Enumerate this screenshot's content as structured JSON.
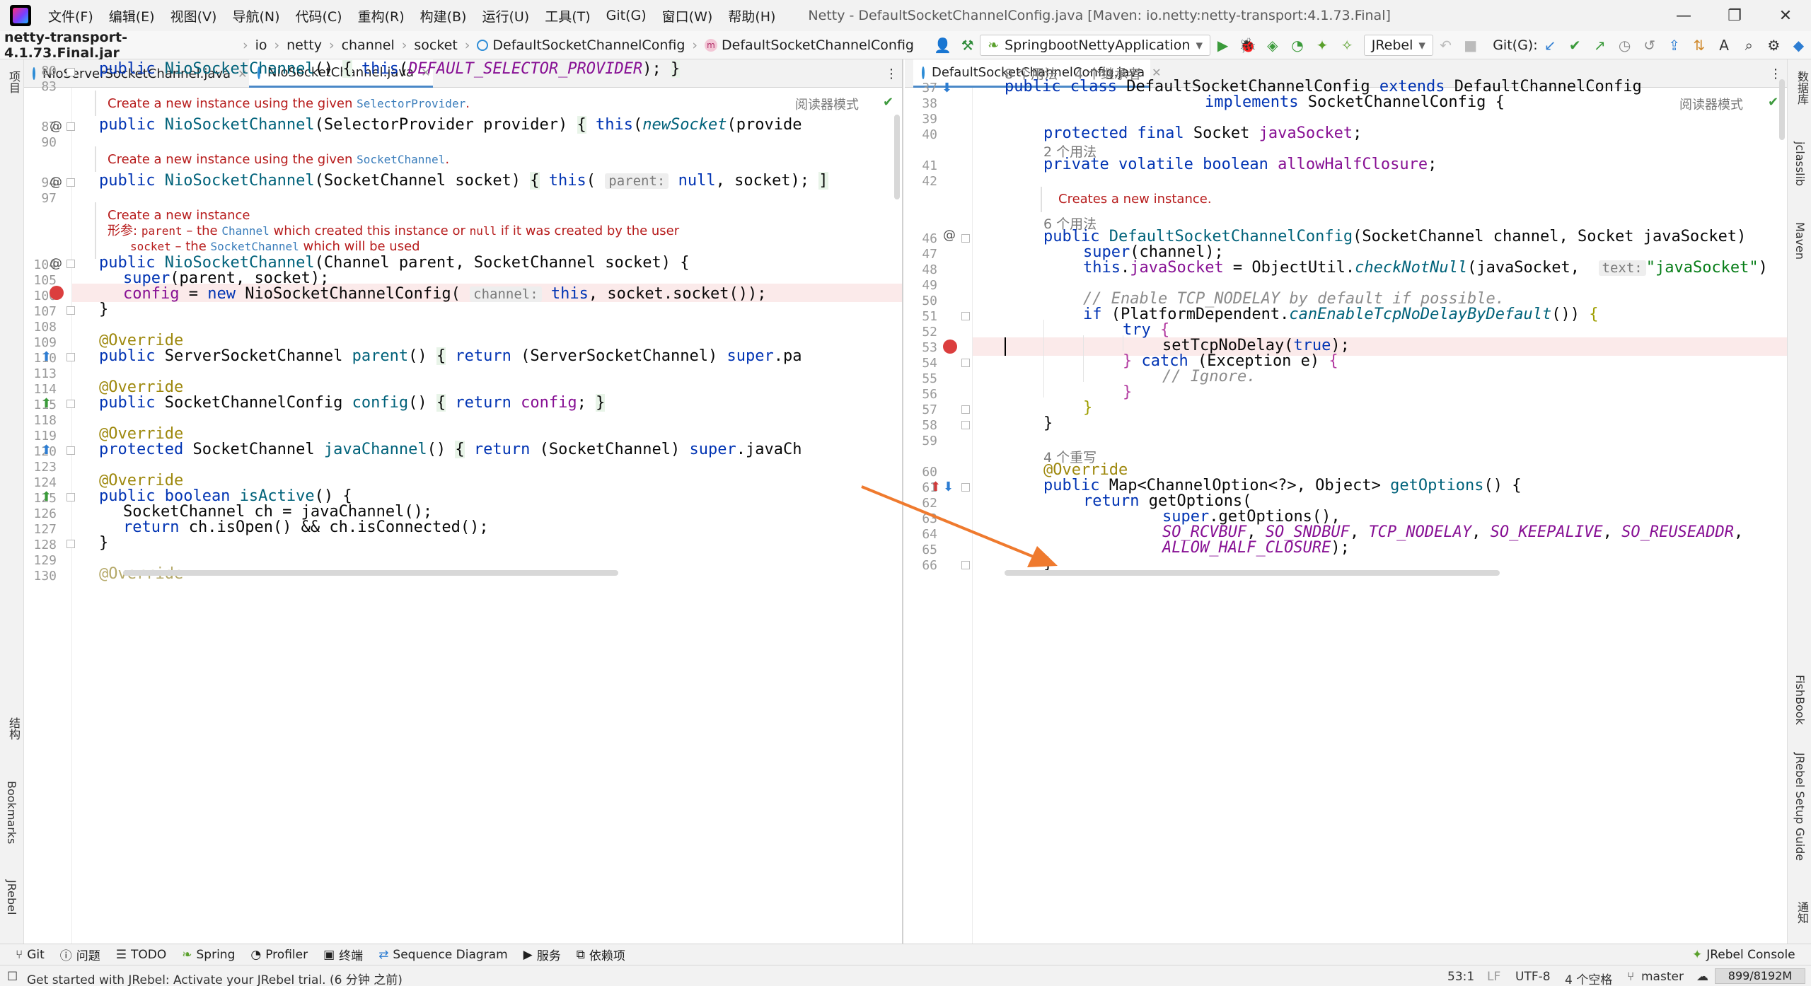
{
  "menu": {
    "items": [
      "文件(F)",
      "编辑(E)",
      "视图(V)",
      "导航(N)",
      "代码(C)",
      "重构(R)",
      "构建(B)",
      "运行(U)",
      "工具(T)",
      "Git(G)",
      "窗口(W)",
      "帮助(H)"
    ],
    "window_title": "Netty - DefaultSocketChannelConfig.java [Maven: io.netty:netty-transport:4.1.73.Final]"
  },
  "breadcrumb": {
    "jar": "netty-transport-4.1.73.Final.jar",
    "parts": [
      "io",
      "netty",
      "channel",
      "socket",
      "DefaultSocketChannelConfig",
      "DefaultSocketChannelConfig"
    ]
  },
  "toolbar": {
    "run_config": "SpringbootNettyApplication",
    "jrebel": "JRebel",
    "git_label": "Git(G):"
  },
  "left_strip": {
    "project": "项目",
    "structure": "结构",
    "bookmarks": "Bookmarks",
    "jrebel": "JRebel"
  },
  "right_strip": {
    "database": "数据库",
    "classlib": "jclasslib",
    "maven": "Maven",
    "fishbook": "FishBook",
    "jrebel_guide": "JRebel Setup Guide",
    "notifications": "通知"
  },
  "left_editor": {
    "tabs": [
      {
        "label": "NioServerSocketChannel.java",
        "active": false
      },
      {
        "label": "NioSocketChannel.java",
        "active": true
      }
    ],
    "reader_mode": "阅读器模式",
    "line_numbers": [
      "80",
      "83",
      "87",
      "90",
      "94",
      "97",
      "104",
      "105",
      "106",
      "107",
      "108",
      "109",
      "110",
      "113",
      "114",
      "115",
      "118",
      "119",
      "120",
      "123",
      "124",
      "125",
      "126",
      "127",
      "128",
      "129",
      "130"
    ],
    "docs": {
      "d1_text": "Create a new instance using the given ",
      "d1_link": "SelectorProvider",
      "d1_end": ".",
      "d2_text": "Create a new instance using the given ",
      "d2_link": "SocketChannel",
      "d2_end": ".",
      "d3_title": "Create a new instance",
      "d3_label": "形参:",
      "d3_p1": "parent",
      "d3_p1_dash": " – the ",
      "d3_p1_link": "Channel",
      "d3_p1_mid": " which created this instance or ",
      "d3_p1_null": "null",
      "d3_p1_end": " if it was created by the user",
      "d3_p2": "socket",
      "d3_p2_dash": " – the ",
      "d3_p2_link": "SocketChannel",
      "d3_p2_end": " which will be used"
    },
    "hints": {
      "parent": "parent:",
      "channel": "channel:"
    }
  },
  "right_editor": {
    "tabs": [
      {
        "label": "DefaultSocketChannelConfig.java",
        "active": true
      }
    ],
    "reader_mode": "阅读器模式",
    "usages": {
      "u1": "8 个用法",
      "u1b": "4 个继承者",
      "u2": "2 个用法",
      "u3": "6 个用法",
      "u4": "4 个重写"
    },
    "doc": {
      "text": "Creates a new instance."
    },
    "hints": {
      "text": "text:"
    },
    "line_numbers": [
      "37",
      "38",
      "39",
      "40",
      "41",
      "42",
      "46",
      "47",
      "48",
      "49",
      "50",
      "51",
      "52",
      "53",
      "54",
      "55",
      "56",
      "57",
      "58",
      "59",
      "60",
      "61",
      "62",
      "63",
      "64",
      "65",
      "66"
    ]
  },
  "bottom_tools": [
    "Git",
    "问题",
    "TODO",
    "Spring",
    "Profiler",
    "终端",
    "Sequence Diagram",
    "服务",
    "依赖项",
    "JRebel Console"
  ],
  "status": {
    "message": "Get started with JRebel: Activate your JRebel trial. (6 分钟 之前)",
    "position": "53:1",
    "line_sep": "LF",
    "encoding": "UTF-8",
    "indent": "4 个空格",
    "branch": "master",
    "memory": "899/8192M"
  }
}
